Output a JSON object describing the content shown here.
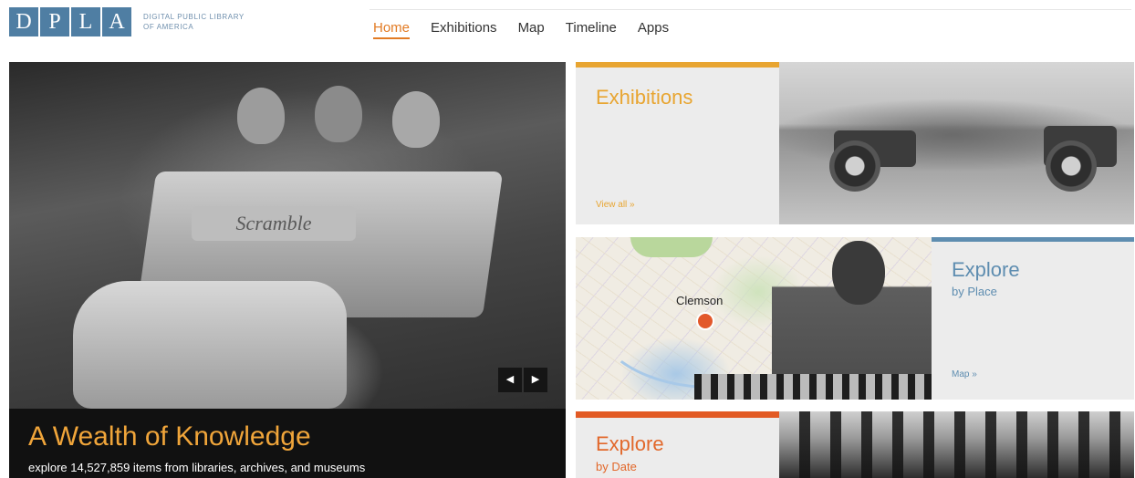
{
  "logo": {
    "letters": [
      "D",
      "P",
      "L",
      "A"
    ],
    "line1": "DIGITAL PUBLIC LIBRARY",
    "line2": "OF AMERICA"
  },
  "nav": {
    "items": [
      {
        "label": "Home",
        "active": true
      },
      {
        "label": "Exhibitions",
        "active": false
      },
      {
        "label": "Map",
        "active": false
      },
      {
        "label": "Timeline",
        "active": false
      },
      {
        "label": "Apps",
        "active": false
      }
    ]
  },
  "hero": {
    "plate_text": "Scramble",
    "title": "A Wealth of Knowledge",
    "subtitle": "explore 14,527,859 items from libraries, archives, and museums",
    "prev_icon": "◀",
    "next_icon": "▶"
  },
  "cards": {
    "exhibitions": {
      "title": "Exhibitions",
      "link": "View all »"
    },
    "place": {
      "title": "Explore",
      "subtitle": "by Place",
      "map_label": "Clemson",
      "link": "Map »"
    },
    "date": {
      "title": "Explore",
      "subtitle": "by Date"
    }
  },
  "colors": {
    "accent_orange": "#e27b24",
    "exhibitions_gold": "#e8a531",
    "place_blue": "#5e8db0",
    "date_red": "#e25a24",
    "logo_blue": "#4f7ea3"
  }
}
